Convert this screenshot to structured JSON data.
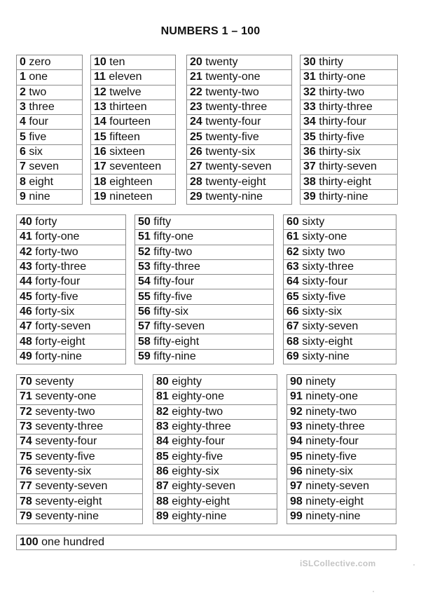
{
  "title": "NUMBERS 1 – 100",
  "tables": [
    {
      "rows": [
        [
          "0",
          "zero"
        ],
        [
          "1",
          "one"
        ],
        [
          "2",
          "two"
        ],
        [
          "3",
          "three"
        ],
        [
          "4",
          "four"
        ],
        [
          "5",
          "five"
        ],
        [
          "6",
          "six"
        ],
        [
          "7",
          "seven"
        ],
        [
          "8",
          "eight"
        ],
        [
          "9",
          "nine"
        ]
      ]
    },
    {
      "rows": [
        [
          "10",
          "ten"
        ],
        [
          "11",
          "eleven"
        ],
        [
          "12",
          "twelve"
        ],
        [
          "13",
          "thirteen"
        ],
        [
          "14",
          "fourteen"
        ],
        [
          "15",
          "fifteen"
        ],
        [
          "16",
          "sixteen"
        ],
        [
          "17",
          "seventeen"
        ],
        [
          "18",
          "eighteen"
        ],
        [
          "19",
          "nineteen"
        ]
      ]
    },
    {
      "rows": [
        [
          "20",
          "twenty"
        ],
        [
          "21",
          "twenty-one"
        ],
        [
          "22",
          "twenty-two"
        ],
        [
          "23",
          "twenty-three"
        ],
        [
          "24",
          "twenty-four"
        ],
        [
          "25",
          "twenty-five"
        ],
        [
          "26",
          "twenty-six"
        ],
        [
          "27",
          "twenty-seven"
        ],
        [
          "28",
          "twenty-eight"
        ],
        [
          "29",
          "twenty-nine"
        ]
      ]
    },
    {
      "rows": [
        [
          "30",
          "thirty"
        ],
        [
          "31",
          "thirty-one"
        ],
        [
          "32",
          "thirty-two"
        ],
        [
          "33",
          "thirty-three"
        ],
        [
          "34",
          "thirty-four"
        ],
        [
          "35",
          "thirty-five"
        ],
        [
          "36",
          "thirty-six"
        ],
        [
          "37",
          "thirty-seven"
        ],
        [
          "38",
          "thirty-eight"
        ],
        [
          "39",
          "thirty-nine"
        ]
      ]
    },
    {
      "rows": [
        [
          "40",
          "forty"
        ],
        [
          "41",
          "forty-one"
        ],
        [
          "42",
          "forty-two"
        ],
        [
          "43",
          "forty-three"
        ],
        [
          "44",
          "forty-four"
        ],
        [
          "45",
          "forty-five"
        ],
        [
          "46",
          "forty-six"
        ],
        [
          "47",
          "forty-seven"
        ],
        [
          "48",
          "forty-eight"
        ],
        [
          "49",
          "forty-nine"
        ]
      ]
    },
    {
      "rows": [
        [
          "50",
          "fifty"
        ],
        [
          "51",
          "fifty-one"
        ],
        [
          "52",
          "fifty-two"
        ],
        [
          "53",
          "fifty-three"
        ],
        [
          "54",
          "fifty-four"
        ],
        [
          "55",
          "fifty-five"
        ],
        [
          "56",
          "fifty-six"
        ],
        [
          "57",
          "fifty-seven"
        ],
        [
          "58",
          "fifty-eight"
        ],
        [
          "59",
          "fifty-nine"
        ]
      ]
    },
    {
      "rows": [
        [
          "60",
          "sixty"
        ],
        [
          "61",
          "sixty-one"
        ],
        [
          "62",
          "sixty two"
        ],
        [
          "63",
          "sixty-three"
        ],
        [
          "64",
          "sixty-four"
        ],
        [
          "65",
          "sixty-five"
        ],
        [
          "66",
          "sixty-six"
        ],
        [
          "67",
          "sixty-seven"
        ],
        [
          "68",
          "sixty-eight"
        ],
        [
          "69",
          "sixty-nine"
        ]
      ]
    },
    {
      "rows": [
        [
          "70",
          "seventy"
        ],
        [
          "71",
          "seventy-one"
        ],
        [
          "72",
          "seventy-two"
        ],
        [
          "73",
          "seventy-three"
        ],
        [
          "74",
          "seventy-four"
        ],
        [
          "75",
          "seventy-five"
        ],
        [
          "76",
          "seventy-six"
        ],
        [
          "77",
          "seventy-seven"
        ],
        [
          "78",
          "seventy-eight"
        ],
        [
          "79",
          "seventy-nine"
        ]
      ]
    },
    {
      "rows": [
        [
          "80",
          "eighty"
        ],
        [
          "81",
          "eighty-one"
        ],
        [
          "82",
          "eighty-two"
        ],
        [
          "83",
          "eighty-three"
        ],
        [
          "84",
          "eighty-four"
        ],
        [
          "85",
          "eighty-five"
        ],
        [
          "86",
          "eighty-six"
        ],
        [
          "87",
          "eighty-seven"
        ],
        [
          "88",
          "eighty-eight"
        ],
        [
          "89",
          "eighty-nine"
        ]
      ]
    },
    {
      "rows": [
        [
          "90",
          "ninety"
        ],
        [
          "91",
          "ninety-one"
        ],
        [
          "92",
          "ninety-two"
        ],
        [
          "93",
          "ninety-three"
        ],
        [
          "94",
          "ninety-four"
        ],
        [
          "95",
          "ninety-five"
        ],
        [
          "96",
          "ninety-six"
        ],
        [
          "97",
          "ninety-seven"
        ],
        [
          "98",
          "ninety-eight"
        ],
        [
          "99",
          "ninety-nine"
        ]
      ]
    },
    {
      "rows": [
        [
          "100",
          "one hundred"
        ]
      ]
    }
  ],
  "watermark": "iSLCollective.com"
}
